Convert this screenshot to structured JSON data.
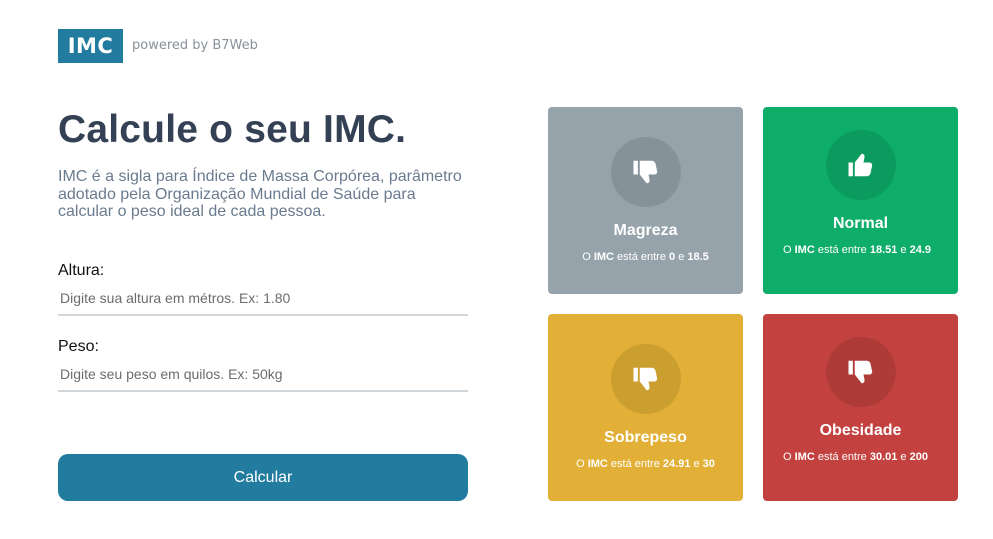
{
  "header": {
    "logo": "IMC",
    "powered": "powered by B7Web"
  },
  "main": {
    "title": "Calcule o seu IMC.",
    "description": "IMC é a sigla para Índice de Massa Corpórea, parâmetro adotado pela Organização Mundial de Saúde para calcular o peso ideal de cada pessoa.",
    "height_label": "Altura:",
    "height_placeholder": "Digite sua altura em métros. Ex: 1.80",
    "height_value": "",
    "weight_label": "Peso:",
    "weight_placeholder": "Digite seu peso em quilos. Ex: 50kg",
    "weight_value": "",
    "calc_button": "Calcular"
  },
  "cards": [
    {
      "title": "Magreza",
      "prefix": "O ",
      "imc": "IMC",
      "mid": " está entre ",
      "min": "0",
      "and": " e ",
      "max": "18.5",
      "color": "#96a3ab",
      "icon": "thumbs-down-icon"
    },
    {
      "title": "Normal",
      "prefix": "O ",
      "imc": "IMC",
      "mid": " está entre ",
      "min": "18.51",
      "and": " e ",
      "max": "24.9",
      "color": "#0ead69",
      "icon": "thumbs-up-icon"
    },
    {
      "title": "Sobrepeso",
      "prefix": "O ",
      "imc": "IMC",
      "mid": " está entre ",
      "min": "24.91",
      "and": " e ",
      "max": "30",
      "color": "#e2b036",
      "icon": "thumbs-down-icon"
    },
    {
      "title": "Obesidade",
      "prefix": "O ",
      "imc": "IMC",
      "mid": " está entre ",
      "min": "30.01",
      "and": " e ",
      "max": "200",
      "color": "#c3423f",
      "icon": "thumbs-down-icon"
    }
  ]
}
